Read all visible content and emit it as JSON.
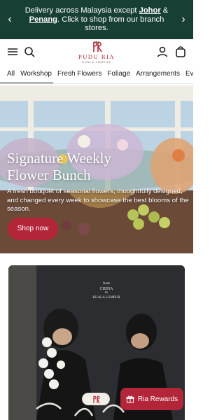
{
  "announcement": {
    "prefix": "Delivery across Malaysia except ",
    "link1": "Johor",
    "joiner": " & ",
    "link2": "Penang",
    "suffix": ". Click to shop from our branch stores."
  },
  "header": {
    "brand_name": "PUDU RIA",
    "brand_sub": "KUALA LUMPUR",
    "brand_color": "#b3263a"
  },
  "nav": {
    "items": [
      "All",
      "Workshop",
      "Fresh Flowers",
      "Foliage",
      "Arrangements",
      "Events"
    ],
    "active": "Workshop"
  },
  "hero": {
    "title": "Signature Weekly Flower Bunch",
    "description": "A fresh bouquet of seasonal flowers, thoughtfully designed, and changed every week to showcase the best blooms of the season.",
    "cta": "Shop now"
  },
  "card": {
    "caption_line1": "from",
    "caption_line2": "CHINA",
    "caption_line3": "to",
    "caption_line4": "KUALA LUMPUR"
  },
  "rewards": {
    "label": "Ria Rewards"
  },
  "colors": {
    "announcement_bg": "#173f36",
    "accent": "#b3263a"
  }
}
